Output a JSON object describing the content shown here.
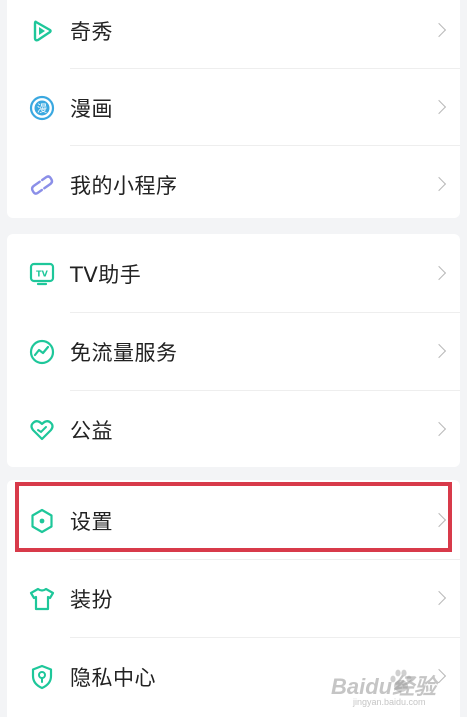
{
  "menu": {
    "group1": [
      {
        "label": "奇秀",
        "icon": "play-triangle-icon"
      },
      {
        "label": "漫画",
        "icon": "comic-icon"
      },
      {
        "label": "我的小程序",
        "icon": "mini-program-link-icon"
      }
    ],
    "group2": [
      {
        "label": "TV助手",
        "icon": "tv-icon"
      },
      {
        "label": "免流量服务",
        "icon": "data-wave-icon"
      },
      {
        "label": "公益",
        "icon": "heart-charity-icon"
      }
    ],
    "group3": [
      {
        "label": "设置",
        "icon": "settings-hexagon-icon"
      },
      {
        "label": "装扮",
        "icon": "tshirt-icon"
      },
      {
        "label": "隐私中心",
        "icon": "privacy-shield-icon"
      }
    ]
  },
  "highlight": {
    "target": "设置",
    "color": "#d83a4a"
  },
  "watermark": {
    "brand": "Baidu经验",
    "url": "jingyan.baidu.com"
  },
  "colors": {
    "accent": "#1ec79a",
    "accent_dark": "#12b27f",
    "comic": "#3aa8e0",
    "link": "#8b8fe8",
    "text": "#222222",
    "chevron": "#b8b8b8",
    "background": "#f3f4f6"
  }
}
